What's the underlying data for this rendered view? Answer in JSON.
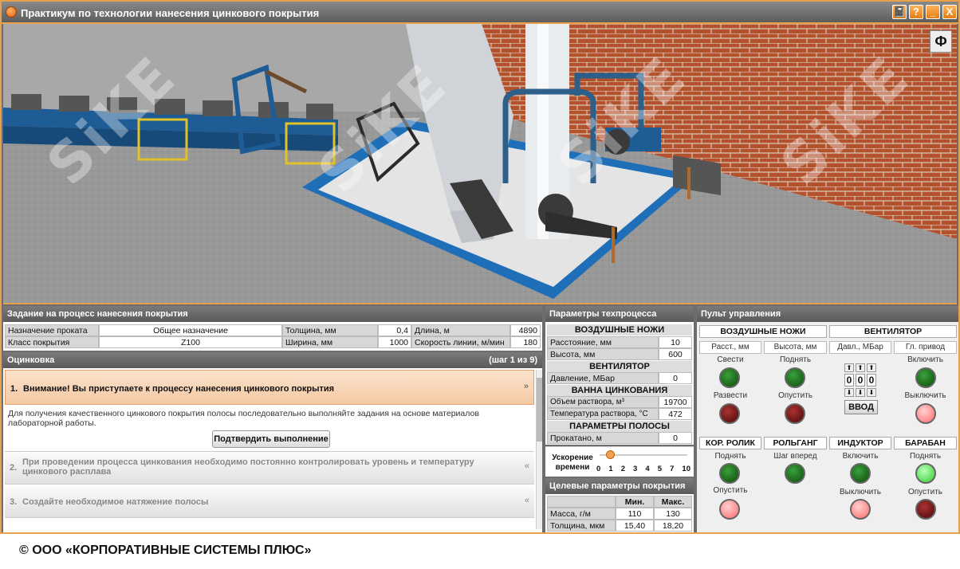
{
  "window": {
    "title": "Практикум по технологии нанесения цинкового покрытия",
    "buttons": [
      "📓",
      "?",
      "_",
      "X"
    ]
  },
  "watermark": "SiKE",
  "task": {
    "header": "Задание на процесс нанесения покрытия",
    "rows": [
      {
        "l1": "Назначение проката",
        "v1": "Общее назначение",
        "l2": "Толщина, мм",
        "v2": "0,4",
        "l3": "Длина, м",
        "v3": "4890"
      },
      {
        "l1": "Класс покрытия",
        "v1": "Z100",
        "l2": "Ширина, мм",
        "v2": "1000",
        "l3": "Скорость линии, м/мин",
        "v3": "180"
      }
    ]
  },
  "steps_panel": {
    "header": "Оцинковка",
    "counter": "(шаг 1 из 9)",
    "step1_num": "1.",
    "step1_title": "Внимание! Вы приступаете к процессу нанесения цинкового покрытия",
    "step1_body": "Для получения качественного цинкового покрытия полосы последовательно выполняйте задания на основе материалов лабораторной работы.",
    "confirm_btn": "Подтвердить выполнение",
    "step2_num": "2.",
    "step2_title": "При проведении процесса цинкования необходимо постоянно контролировать уровень и температуру цинкового расплава",
    "step3_num": "3.",
    "step3_title": "Создайте необходимое натяжение полосы"
  },
  "process": {
    "header": "Параметры техпроцесса",
    "air_knives": "ВОЗДУШНЫЕ НОЖИ",
    "distance_lbl": "Расстояние, мм",
    "distance_val": "10",
    "height_lbl": "Высота, мм",
    "height_val": "600",
    "fan": "ВЕНТИЛЯТОР",
    "pressure_lbl": "Давление, МБар",
    "pressure_val": "0",
    "bath": "ВАННА ЦИНКОВАНИЯ",
    "volume_lbl": "Объем раствора, м³",
    "volume_val": "19700",
    "temp_lbl": "Температура раствора, °С",
    "temp_val": "472",
    "strip": "ПАРАМЕТРЫ ПОЛОСЫ",
    "rolled_lbl": "Прокатано, м",
    "rolled_val": "0",
    "accel_lbl": "Ускорение времени",
    "accel_ticks": [
      "0",
      "1",
      "2",
      "3",
      "4",
      "5",
      "7",
      "10"
    ],
    "accel_value": 0
  },
  "targets": {
    "header": "Целевые параметры покрытия",
    "col_min": "Мин.",
    "col_max": "Макс.",
    "rows": [
      {
        "label": "Масса, г/м",
        "min": "110",
        "max": "130"
      },
      {
        "label": "Толщина, мкм",
        "min": "15,40",
        "max": "18,20"
      }
    ]
  },
  "control": {
    "header": "Пульт управления",
    "air_knives": "ВОЗДУШНЫЕ НОЖИ",
    "fan": "ВЕНТИЛЯТОР",
    "sub_dist": "Расст., мм",
    "sub_height": "Высота, мм",
    "sub_pressure": "Давл., МБар",
    "sub_drive": "Гл. привод",
    "bring": "Свести",
    "raise": "Поднять",
    "on1": "Включить",
    "spread": "Развести",
    "lower": "Опустить",
    "off1": "Выключить",
    "digits": [
      "0",
      "0",
      "0"
    ],
    "enter": "ВВОД",
    "corr_roll": "КОР. РОЛИК",
    "roller": "РОЛЬГАНГ",
    "inductor": "ИНДУКТОР",
    "drum": "БАРАБАН",
    "cr_raise": "Поднять",
    "cr_lower": "Опустить",
    "rg_step": "Шаг вперед",
    "ind_on": "Включить",
    "ind_off": "Выключить",
    "dr_raise": "Поднять",
    "dr_lower": "Опустить"
  },
  "footer": "© ООО «КОРПОРАТИВНЫЕ СИСТЕМЫ ПЛЮС»",
  "colors": {
    "accent": "#e8a04a",
    "conveyor": "#1e6fb8",
    "brick": "#b5522e"
  }
}
